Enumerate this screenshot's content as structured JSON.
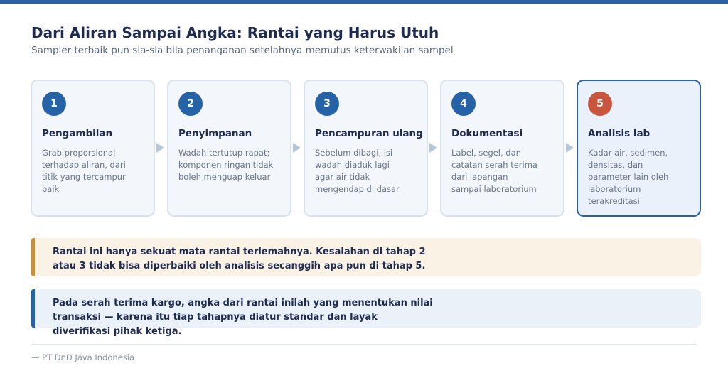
{
  "header": {
    "title": "Dari Aliran Sampai Angka: Rantai yang Harus Utuh",
    "subtitle": "Sampler terbaik pun sia-sia bila penanganan setelahnya memutus keterwakilan sampel"
  },
  "steps": [
    {
      "number": "1",
      "title": "Pengambilan",
      "desc": "Grab proporsional terhadap aliran, dari titik yang tercampur baik"
    },
    {
      "number": "2",
      "title": "Penyimpanan",
      "desc": "Wadah tertutup rapat; komponen ringan tidak boleh menguap keluar"
    },
    {
      "number": "3",
      "title": "Pencampuran ulang",
      "desc": "Sebelum dibagi, isi wadah diaduk lagi agar air tidak mengendap di dasar"
    },
    {
      "number": "4",
      "title": "Dokumentasi",
      "desc": "Label, segel, dan catatan serah terima dari lapangan sampai laboratorium"
    },
    {
      "number": "5",
      "title": "Analisis lab",
      "desc": "Kadar air, sedimen, densitas, dan parameter lain oleh laboratorium terakreditasi"
    }
  ],
  "callouts": {
    "warning": "Rantai ini hanya sekuat mata rantai terlemahnya. Kesalahan di tahap 2 atau 3 tidak bisa diperbaiki oleh analisis secanggih apa pun di tahap 5.",
    "info": "Pada serah terima kargo, angka dari rantai inilah yang menentukan nilai transaksi — karena itu tiap tahapnya diatur standar dan layak diverifikasi pihak ketiga."
  },
  "footer": {
    "text": "— PT DnD Java Indonesia"
  },
  "colors": {
    "accent": "#2563a6",
    "highlight": "#c8553d",
    "warning": "#c8913c"
  }
}
